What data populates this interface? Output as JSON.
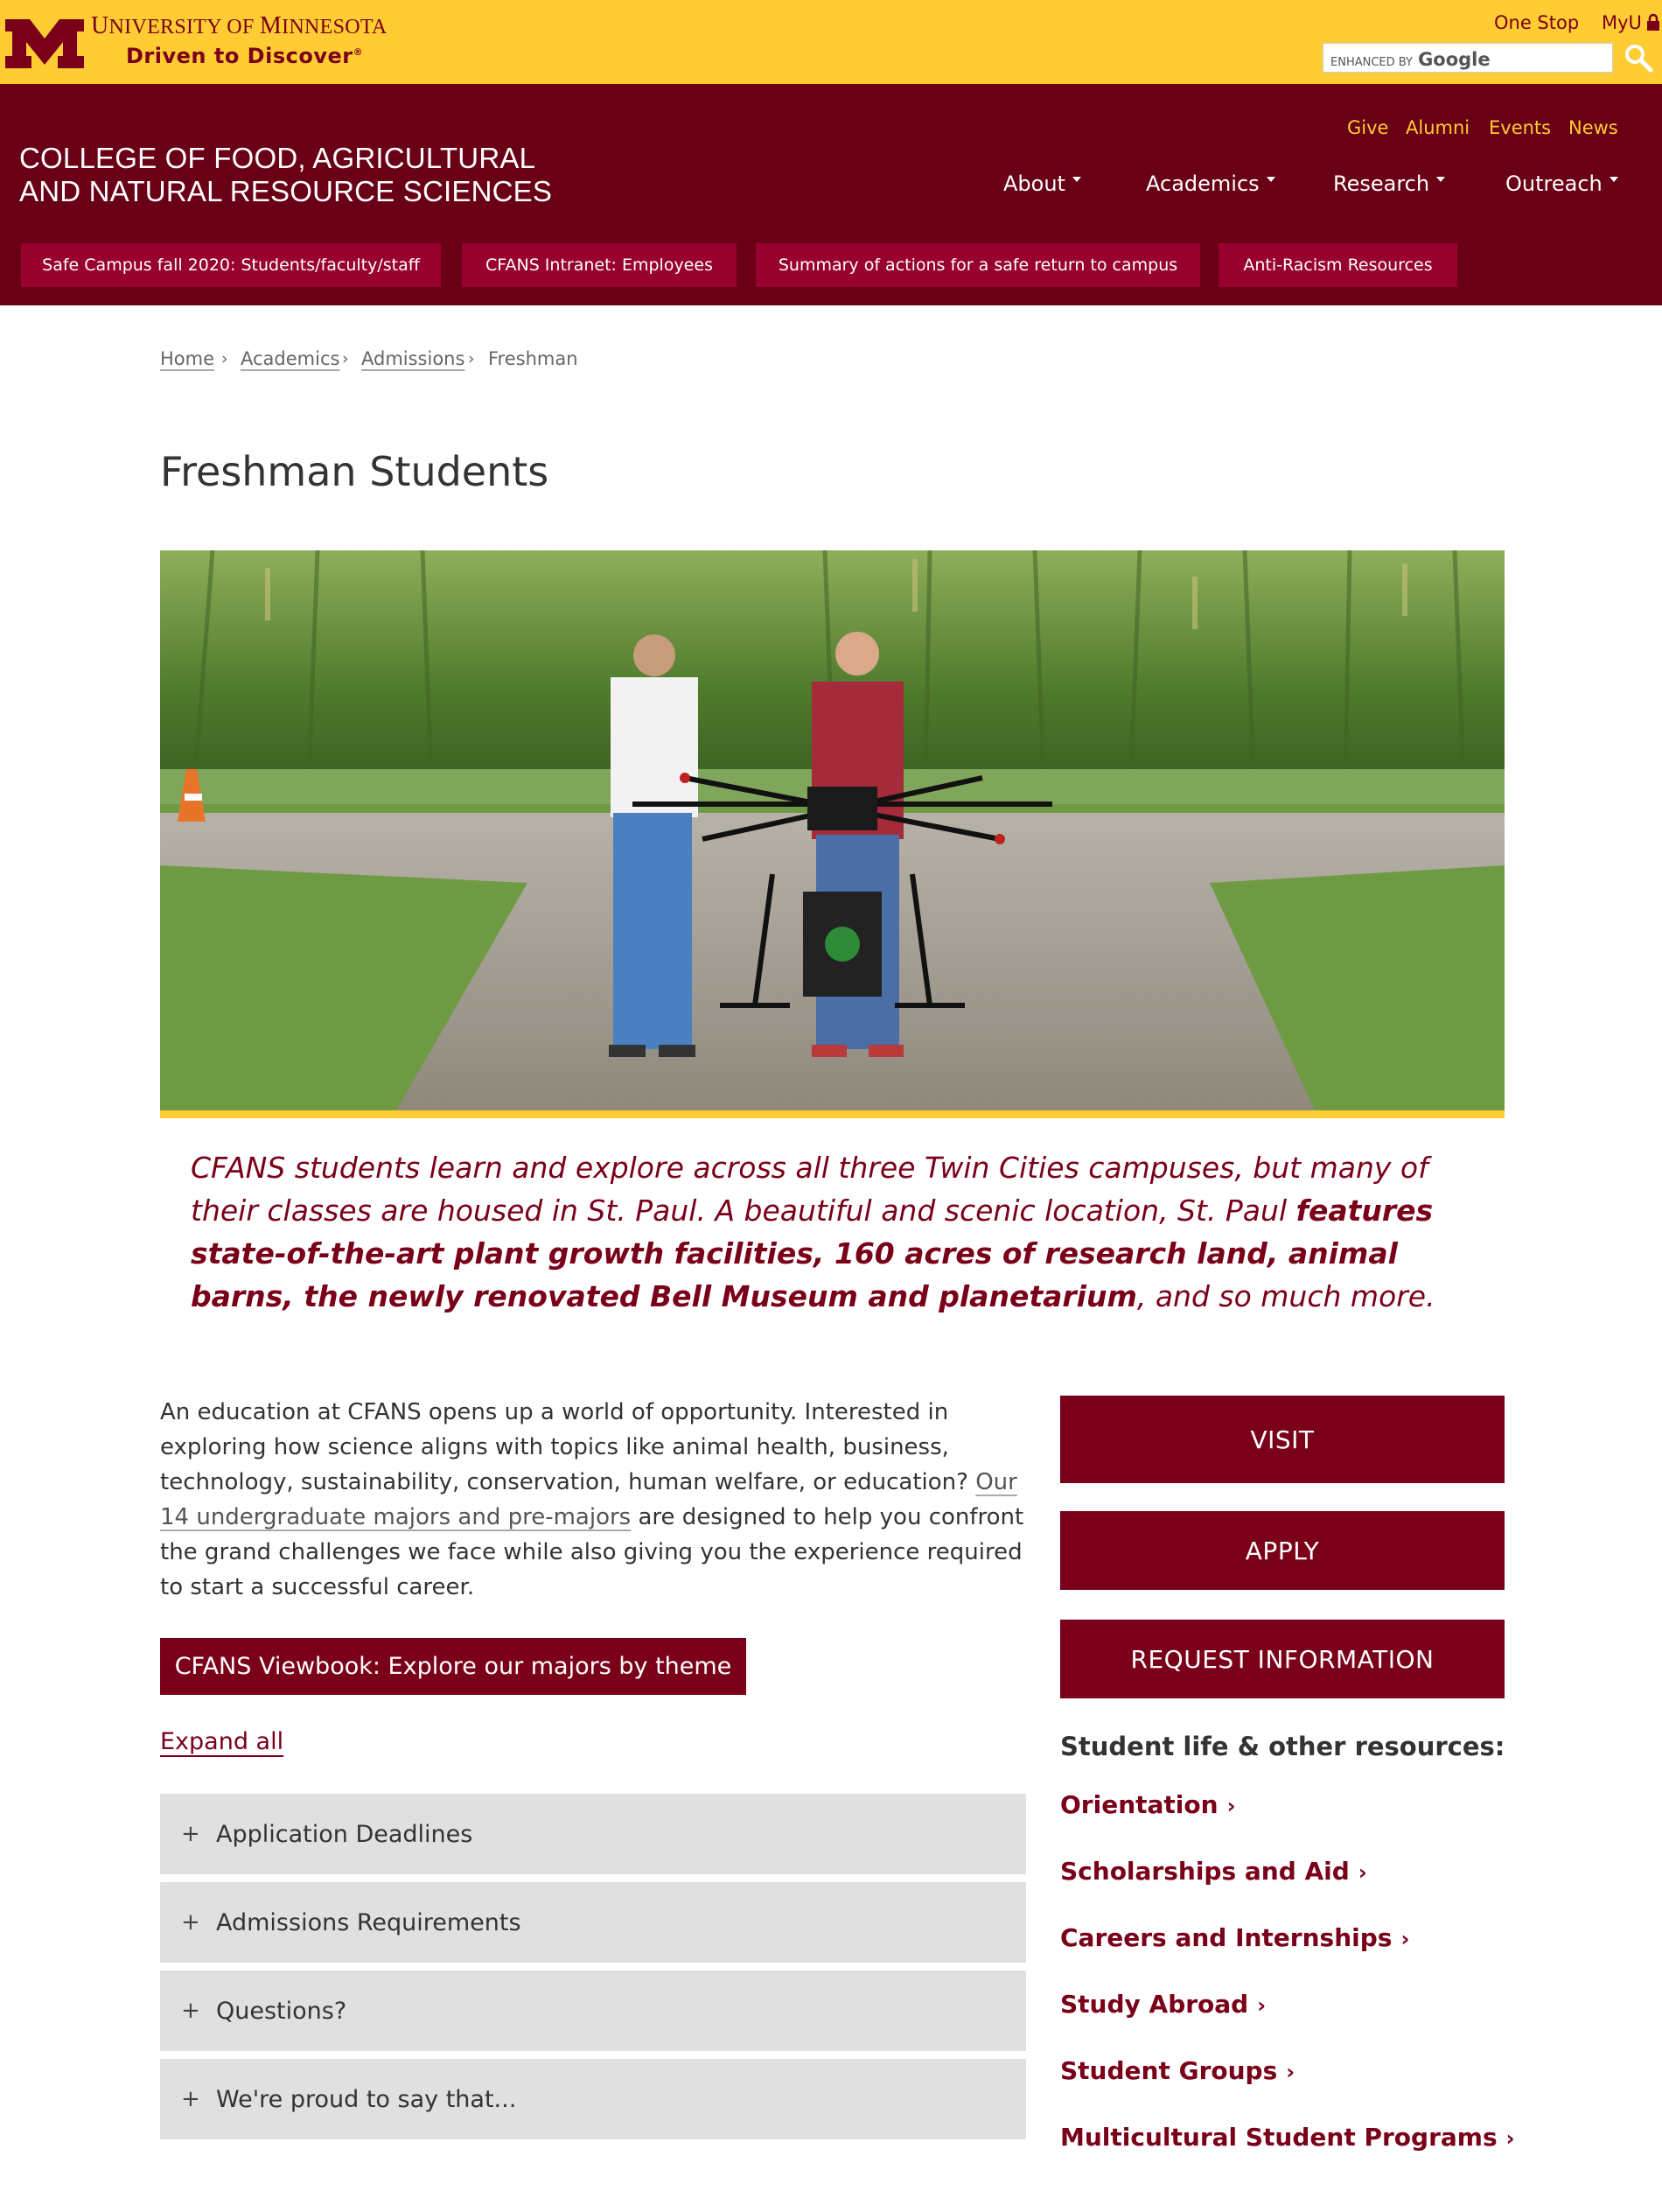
{
  "university": {
    "name_initial_1": "U",
    "name_rest_1": "NIVERSITY OF ",
    "name_initial_2": "M",
    "name_rest_2": "INNESOTA",
    "tagline": "Driven to Discover",
    "tagline_mark": "®"
  },
  "top_links": {
    "one_stop": "One Stop",
    "myu": "MyU"
  },
  "search": {
    "enhanced_by": "ENHANCED BY",
    "brand": "Google"
  },
  "college": {
    "line1": "College of Food, Agricultural",
    "line2": "and Natural Resource Sciences"
  },
  "utility_nav": [
    "Give",
    "Alumni",
    "Events",
    "News"
  ],
  "main_nav": [
    "About",
    "Academics",
    "Research",
    "Outreach"
  ],
  "alert_buttons": [
    "Safe Campus fall 2020: Students/faculty/staff",
    "CFANS Intranet: Employees",
    "Summary of actions for a safe return to campus",
    "Anti-Racism Resources"
  ],
  "breadcrumb": [
    "Home",
    "Academics",
    "Admissions",
    "Freshman"
  ],
  "page_title": "Freshman Students",
  "lead": {
    "part1": "CFANS students learn and explore across all three Twin Cities campuses, but many of their classes are housed in St. Paul. A beautiful and scenic location, St. Paul ",
    "bold": "features state-of-the-art plant growth facilities, 160 acres of research land, animal barns, the newly renovated Bell Museum and planetarium",
    "part2": ", and so much more."
  },
  "body": {
    "text1": "An education at CFANS opens up a world of opportunity. Interested in exploring how science aligns with topics like animal health, business, technology, sustainability, conservation, human welfare, or education? ",
    "link": "Our 14 undergraduate majors and pre-majors",
    "text2": " are designed to help you confront the grand challenges we face while also giving you the experience required to start a successful career."
  },
  "viewbook_button": "CFANS Viewbook: Explore our majors by theme",
  "expand_all": "Expand all",
  "accordion": [
    "Application Deadlines",
    "Admissions Requirements",
    "Questions?",
    "We're proud to say that..."
  ],
  "cta": [
    "VISIT",
    "APPLY",
    "REQUEST INFORMATION"
  ],
  "resources_heading": "Student life & other resources:",
  "resources": [
    "Orientation",
    "Scholarships and Aid",
    "Careers and Internships",
    "Study Abroad",
    "Student Groups",
    "Multicultural Student Programs"
  ],
  "colors": {
    "gold": "#ffcc33",
    "maroon": "#7a0019",
    "header_maroon": "#690016",
    "alert_red": "#98002e"
  }
}
